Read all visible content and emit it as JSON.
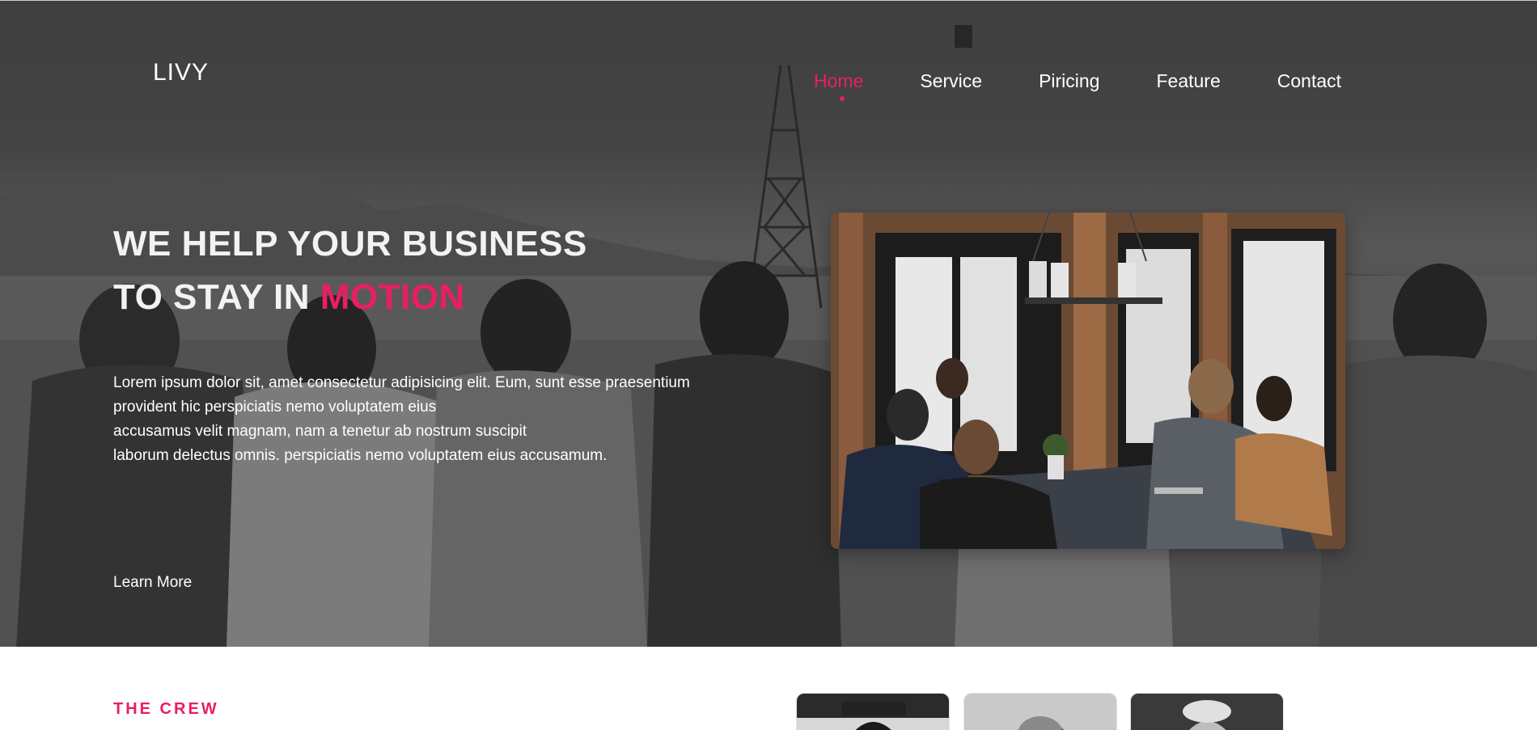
{
  "brand": {
    "logo": "LIVY",
    "accent_color": "#e91e63"
  },
  "nav": {
    "items": [
      {
        "label": "Home",
        "active": true
      },
      {
        "label": "Service",
        "active": false
      },
      {
        "label": "Piricing",
        "active": false
      },
      {
        "label": "Feature",
        "active": false
      },
      {
        "label": "Contact",
        "active": false
      }
    ]
  },
  "hero": {
    "headline_line1": "WE HELP YOUR BUSINESS",
    "headline_line2_prefix": "TO STAY IN ",
    "headline_line2_accent": "MOTION",
    "lead_lines": [
      "Lorem ipsum dolor sit, amet consectetur adipisicing elit. Eum, sunt esse praesentium",
      "provident hic perspiciatis nemo voluptatem eius",
      "accusamus velit magnam, nam a tenetur ab nostrum suscipit",
      "laborum delectus omnis. perspiciatis nemo voluptatem eius accusamum."
    ],
    "cta_label": "Learn More",
    "background_image": "group-of-friends-by-the-sea-photo",
    "card_image": "team-meeting-photo"
  },
  "crew": {
    "label": "THE CREW",
    "photos": [
      "crew-member-1-photo",
      "crew-member-2-photo",
      "crew-member-3-photo"
    ]
  }
}
